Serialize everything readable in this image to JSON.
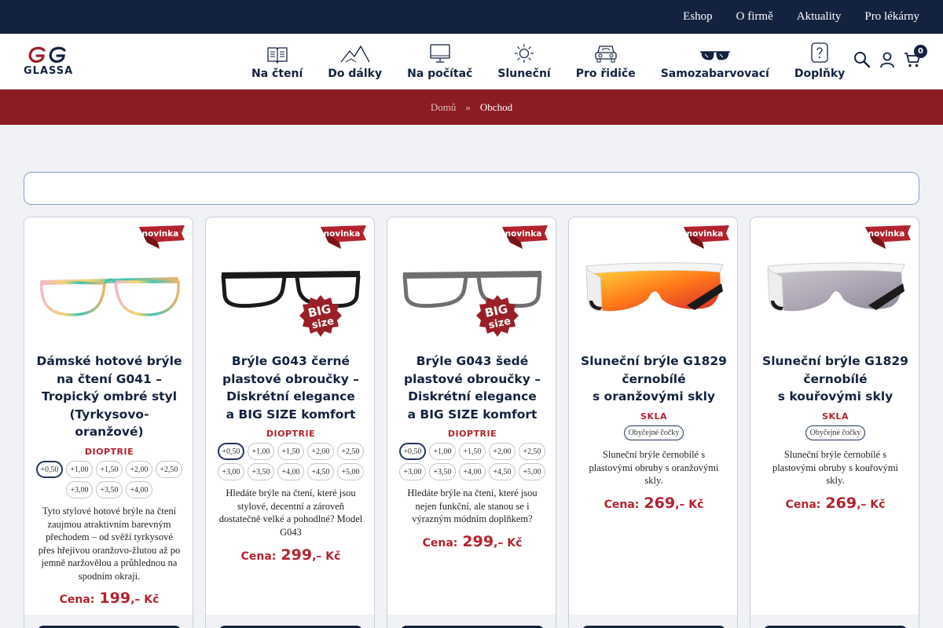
{
  "topbar": {
    "links": [
      "Eshop",
      "O firmě",
      "Aktuality",
      "Pro lékárny"
    ]
  },
  "logo": {
    "text": "GLASSA"
  },
  "nav": [
    {
      "label": "Na čtení",
      "icon": "book-icon"
    },
    {
      "label": "Do dálky",
      "icon": "mountains-icon"
    },
    {
      "label": "Na počítač",
      "icon": "monitor-icon"
    },
    {
      "label": "Sluneční",
      "icon": "sun-icon"
    },
    {
      "label": "Pro řidiče",
      "icon": "car-icon"
    },
    {
      "label": "Samozabarvovací",
      "icon": "sunglasses-icon"
    },
    {
      "label": "Doplňky",
      "icon": "bottle-icon"
    }
  ],
  "header_icons": {
    "search": "search-icon",
    "account": "user-icon",
    "cart": "cart-icon",
    "cart_count": "0"
  },
  "breadcrumb": {
    "home": "Domů",
    "separator": "»",
    "current": "Obchod"
  },
  "colors": {
    "navy": "#13233f",
    "burgundy": "#8c1c24",
    "accent_red": "#b3232e"
  },
  "badge": {
    "label": "novinka"
  },
  "products": [
    {
      "title": "Dámské hotové brýle na čtení G041 – Tropický ombré styl (Tyrkysovo-oranžové)",
      "title_lines": [
        "Dámské hotové brýle",
        "na čtení G041 –",
        "Tropický ombré styl",
        "(Tyrkysovo-",
        "oranžové)"
      ],
      "section": "DIOPTRIE",
      "options": [
        "+0,50",
        "+1,00",
        "+1,50",
        "+2,00",
        "+2,50",
        "+3,00",
        "+3,50",
        "+4,00"
      ],
      "selected": "+0,50",
      "description": "Tyto stylové hotové brýle na čtení zaujmou atraktivním barevným přechodem – od svěží tyrkysové přes hřejivou oranžovo-žlutou až po jemně naržovělou a průhlednou na spodním okraji.",
      "price_label": "Cena:",
      "price": "199",
      "currency": ",– Kč",
      "big_size": false
    },
    {
      "title": "Brýle G043 černé plastové obroučky – Diskrétní elegance a BIG SIZE komfort",
      "title_lines": [
        "Brýle G043 černé",
        "plastové obroučky –",
        "Diskrétní elegance",
        "a BIG SIZE komfort"
      ],
      "section": "DIOPTRIE",
      "options": [
        "+0,50",
        "+1,00",
        "+1,50",
        "+2,00",
        "+2,50",
        "+3,00",
        "+3,50",
        "+4,00",
        "+4,50",
        "+5,00"
      ],
      "selected": "+0,50",
      "description": "Hledáte brýle na čtení, které jsou stylové, decentní a zároveň dostatečně velké a pohodlné? Model G043",
      "price_label": "Cena:",
      "price": "299",
      "currency": ",– Kč",
      "big_size": true,
      "big_size_text": [
        "BIG",
        "size"
      ]
    },
    {
      "title": "Brýle G043 šedé plastové obroučky – Diskrétní elegance a BIG SIZE komfort",
      "title_lines": [
        "Brýle G043 šedé",
        "plastové obroučky –",
        "Diskrétní elegance",
        "a BIG SIZE komfort"
      ],
      "section": "DIOPTRIE",
      "options": [
        "+0,50",
        "+1,00",
        "+1,50",
        "+2,00",
        "+2,50",
        "+3,00",
        "+3,50",
        "+4,00",
        "+4,50",
        "+5,00"
      ],
      "selected": "+0,50",
      "description": "Hledáte brýle na čtení, které jsou nejen funkční, ale stanou se i výrazným módním doplňkem?",
      "price_label": "Cena:",
      "price": "299",
      "currency": ",– Kč",
      "big_size": true,
      "big_size_text": [
        "BIG",
        "size"
      ]
    },
    {
      "title": "Sluneční brýle G1829 černobílé s oranžovými skly",
      "title_lines": [
        "Sluneční brýle G1829",
        "černobílé",
        "s oranžovými skly"
      ],
      "section": "SKLA",
      "glass_option": "Obyčejné čočky",
      "description": "Sluneční brýle černobílé s plastovými obruby s oranžovými skly.",
      "price_label": "Cena:",
      "price": "269",
      "currency": ",– Kč",
      "big_size": false
    },
    {
      "title": "Sluneční brýle G1829 černobílé s kouřovými skly",
      "title_lines": [
        "Sluneční brýle G1829",
        "černobílé",
        "s kouřovými skly"
      ],
      "section": "SKLA",
      "glass_option": "Obyčejné čočky",
      "description": "Sluneční brýle černobílé s plastovými obruby s kouřovými skly.",
      "price_label": "Cena:",
      "price": "269",
      "currency": ",– Kč",
      "big_size": false
    }
  ]
}
